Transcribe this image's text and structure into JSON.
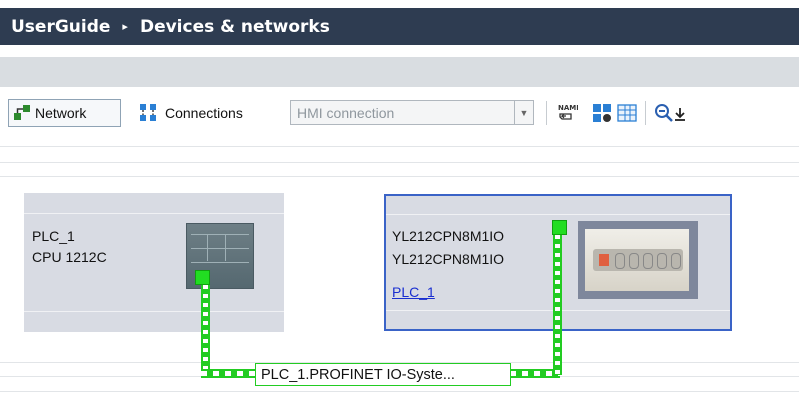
{
  "breadcrumb": {
    "root": "UserGuide",
    "separator": "▸",
    "current": "Devices & networks"
  },
  "toolbar": {
    "network_label": "Network",
    "connections_label": "Connections",
    "connection_type": "HMI connection"
  },
  "devices": {
    "plc": {
      "name": "PLC_1",
      "type": "CPU 1212C"
    },
    "io": {
      "name": "YL212CPN8M1IO",
      "type": "YL212CPN8M1IO",
      "controller_link": "PLC_1"
    }
  },
  "network": {
    "label": "PLC_1.PROFINET IO-Syste..."
  },
  "colors": {
    "titlebar": "#2e3c51",
    "profinet": "#22cc22",
    "selection": "#3a63c7",
    "link": "#1a2fd0"
  }
}
